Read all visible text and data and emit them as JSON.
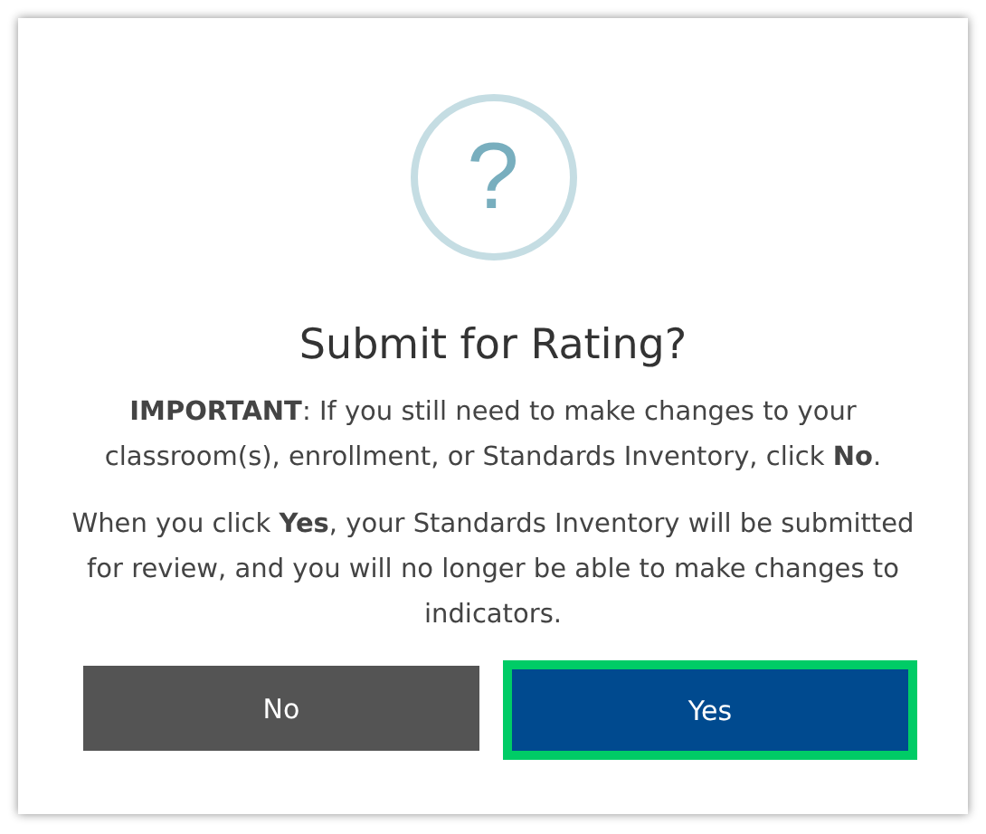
{
  "dialog": {
    "icon_glyph": "?",
    "title": "Submit for Rating?",
    "paragraphs": [
      "**IMPORTANT**: If you still need to make changes to your classroom(s), enrollment, or Standards Inventory, click **No**.",
      "When you click **Yes**, your Standards Inventory will be submitted for review, and you will no longer be able to make changes to indicators."
    ],
    "buttons": [
      {
        "label": "No",
        "kind": "secondary",
        "highlighted": false
      },
      {
        "label": "Yes",
        "kind": "primary",
        "highlighted": true
      }
    ]
  }
}
